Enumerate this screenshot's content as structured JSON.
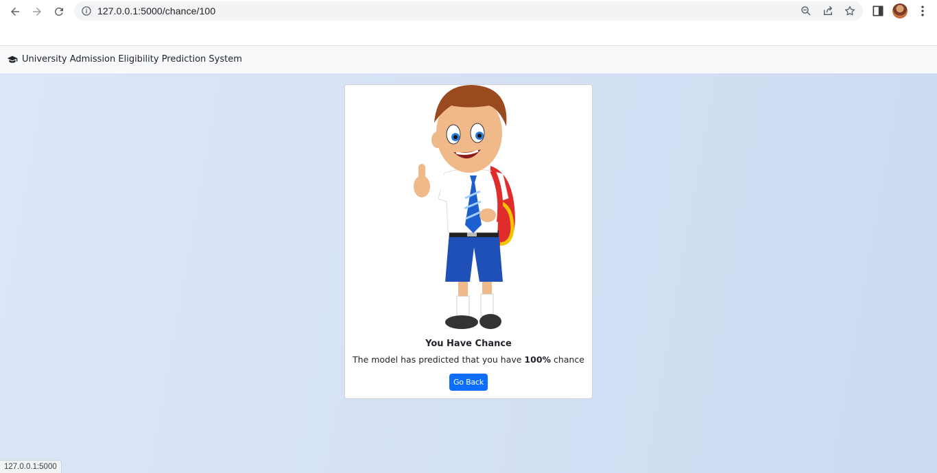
{
  "browser": {
    "url": "127.0.0.1:5000/chance/100",
    "status_url": "127.0.0.1:5000",
    "icons": [
      "back-icon",
      "forward-icon",
      "reload-icon",
      "info-icon",
      "zoom-icon",
      "share-icon",
      "bookmark-star-icon",
      "side-panel-icon",
      "profile-avatar",
      "menu-icon"
    ]
  },
  "navbar": {
    "brand_icon": "graduation-cap-icon",
    "title": "University Admission Eligibility Prediction System"
  },
  "result": {
    "image": "cartoon-schoolboy-thumbs-up",
    "title": "You Have Chance",
    "text_prefix": "The model has predicted that you have ",
    "chance": "100%",
    "text_suffix": " chance",
    "button_label": "Go Back"
  },
  "colors": {
    "primary_button": "#0d6efd",
    "navbar_bg": "#f8f9fa",
    "page_bg": "#d3dff3"
  }
}
